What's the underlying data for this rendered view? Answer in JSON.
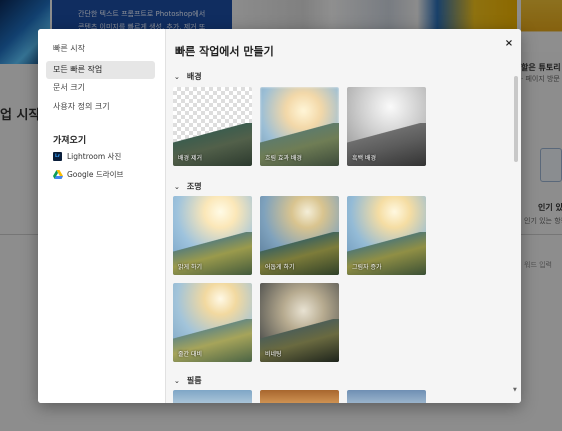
{
  "background": {
    "banner_line1": "간단한 텍스트 프롬프트로 Photoshop에서",
    "banner_line2": "콘텐츠 이미지를 빠르게 생성, 추가, 제거 또",
    "left_title": "업 시작",
    "right_title": "할은 튜토리",
    "right_sub": "· 페이지 방문",
    "right_heading": "인기 있",
    "right_desc": "인기 있는 항목",
    "right_more": "워드 입력"
  },
  "sidebar": {
    "items": [
      {
        "label": "빠른 시작",
        "active": false
      },
      {
        "label": "모든 빠른 작업",
        "active": true
      },
      {
        "label": "문서 크기",
        "active": false
      },
      {
        "label": "사용자 정의 크기",
        "active": false
      }
    ],
    "import_heading": "가져오기",
    "import_links": [
      {
        "label": "Lightroom 사진",
        "icon": "lightroom-icon"
      },
      {
        "label": "Google 드라이브",
        "icon": "google-drive-icon"
      }
    ]
  },
  "content": {
    "title": "빠른 작업에서 만들기",
    "close_label": "×",
    "sections": [
      {
        "label": "배경",
        "cards": [
          "배경 제거",
          "흐림 효과 배경",
          "흑백 배경"
        ]
      },
      {
        "label": "조명",
        "cards": [
          "밝게 하기",
          "어둡게 하기",
          "그림자 증가",
          "줄간 대비",
          "비네팅"
        ]
      },
      {
        "label": "필름",
        "cards": []
      }
    ]
  },
  "colors": {
    "active_item_bg": "#e6e6e6",
    "accent_blue": "#1d4fa6"
  }
}
